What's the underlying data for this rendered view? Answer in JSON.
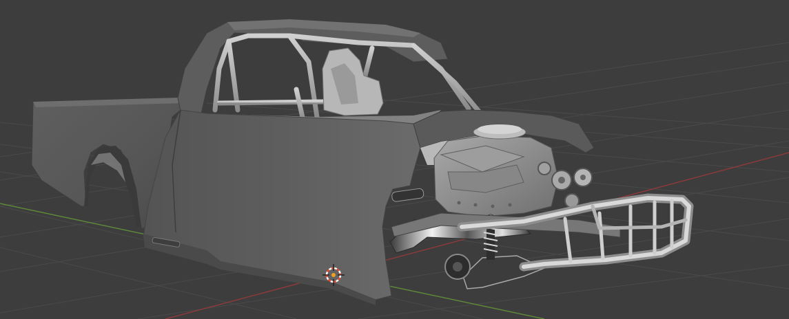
{
  "app": {
    "kind": "3D viewport"
  },
  "viewport": {
    "background": "#3d3d3d",
    "grid_color": "#4a4a4a",
    "axis_x_color": "#8c3a3a",
    "axis_y_color": "#5d8a3a"
  },
  "scene": {
    "object": "pickup-truck-race-chassis",
    "material": "grey-clay"
  },
  "icons": {
    "cursor": "3d-cursor-icon"
  },
  "colors": {
    "body": "#5a5a5a",
    "body_dark": "#4b4b4b",
    "body_light": "#6a6a6a",
    "frame": "#9a9a9a",
    "frame_light": "#c7c7c7",
    "engine": "#8f8f8f",
    "cursor_ring_a": "#e84a2a",
    "cursor_ring_b": "#ffffff",
    "cursor_center": "#f0a020"
  }
}
